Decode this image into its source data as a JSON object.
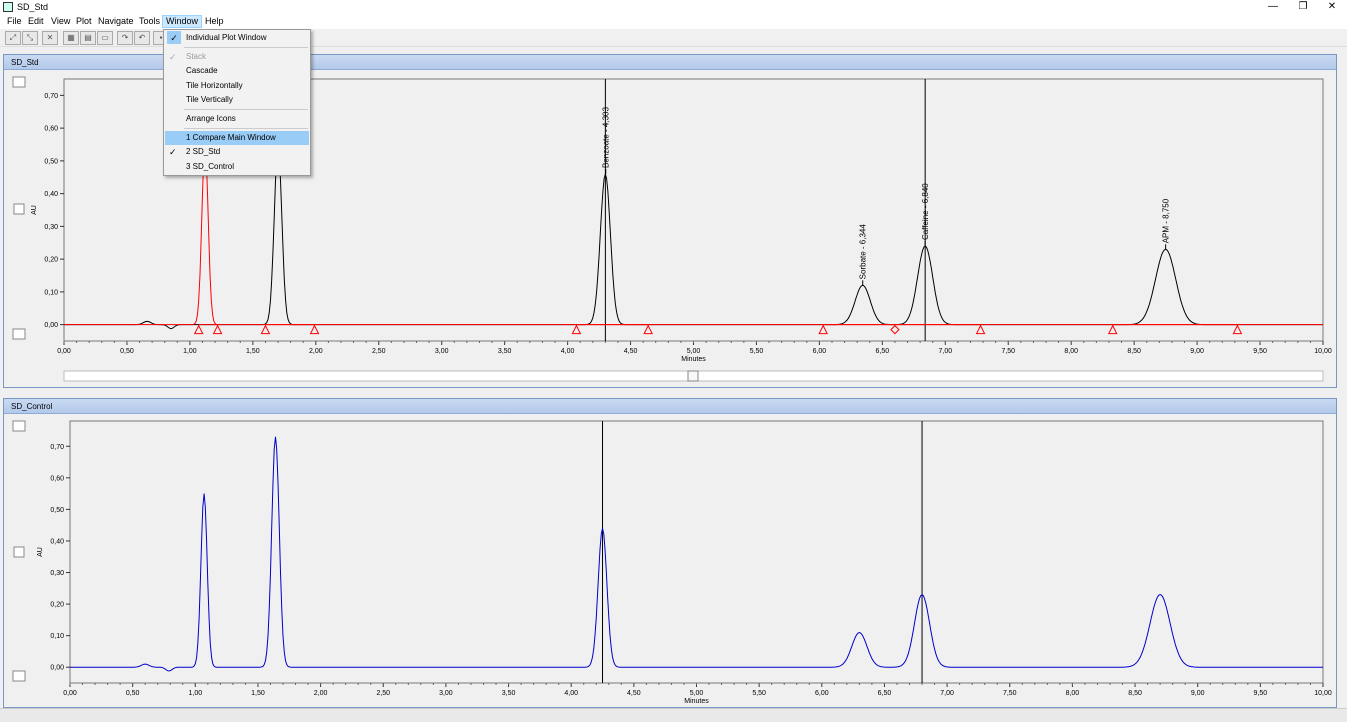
{
  "window": {
    "title": "SD_Std",
    "minimize": "—",
    "restore": "❐",
    "close": "✕"
  },
  "menu": [
    "File",
    "Edit",
    "View",
    "Plot",
    "Navigate",
    "Tools",
    "Window",
    "Help"
  ],
  "window_menu": {
    "individual_plot": "Individual Plot Window",
    "stack": "Stack",
    "cascade": "Cascade",
    "tile_h": "Tile Horizontally",
    "tile_v": "Tile Vertically",
    "arrange": "Arrange Icons",
    "win1": "1 Compare Main Window",
    "win2": "2 SD_Std",
    "win3": "3 SD_Control"
  },
  "panels": {
    "top_title": "SD_Std",
    "bottom_title": "SD_Control"
  },
  "chart_data": [
    {
      "type": "line",
      "title": "SD_Std",
      "xlabel": "Minutes",
      "ylabel": "AU",
      "xlim": [
        0,
        10
      ],
      "ylim": [
        -0.05,
        0.75
      ],
      "x_ticks": [
        "0,00",
        "0,50",
        "1,00",
        "1,50",
        "2,00",
        "2,50",
        "3,00",
        "3,50",
        "4,00",
        "4,50",
        "5,00",
        "5,50",
        "6,00",
        "6,50",
        "7,00",
        "7,50",
        "8,00",
        "8,50",
        "9,00",
        "9,50",
        "10,00"
      ],
      "y_ticks": [
        "0,00",
        "0,10",
        "0,20",
        "0,30",
        "0,40",
        "0,50",
        "0,60",
        "0,70"
      ],
      "series": [
        {
          "color": "#000000",
          "peaks": [
            [
              0.66,
              0.01,
              0.03
            ],
            [
              1.7,
              0.55,
              0.03
            ],
            [
              4.3,
              0.46,
              0.04
            ],
            [
              6.344,
              0.12,
              0.06
            ],
            [
              6.84,
              0.24,
              0.06
            ],
            [
              8.75,
              0.23,
              0.08
            ]
          ]
        },
        {
          "color": "#ff0000",
          "peaks": [
            [
              1.12,
              0.55,
              0.025
            ]
          ]
        }
      ],
      "peak_labels": [
        {
          "x": 4.303,
          "y": 0.46,
          "text": "Benzoate - 4,303"
        },
        {
          "x": 6.344,
          "y": 0.12,
          "text": "Sorbate - 6,344"
        },
        {
          "x": 6.84,
          "y": 0.24,
          "text": "Caffeine - 6,840"
        },
        {
          "x": 8.75,
          "y": 0.23,
          "text": "APM - 8,750"
        }
      ],
      "cursor_lines": [
        4.3,
        6.84
      ],
      "triangle_markers": [
        1.07,
        1.22,
        1.6,
        1.99,
        4.07,
        4.64,
        6.03,
        7.28,
        8.33,
        9.32
      ],
      "diamond_markers": [
        6.6
      ]
    },
    {
      "type": "line",
      "title": "SD_Control",
      "xlabel": "Minutes",
      "ylabel": "AU",
      "xlim": [
        0,
        10
      ],
      "ylim": [
        -0.05,
        0.78
      ],
      "x_ticks": [
        "0,00",
        "0,50",
        "1,00",
        "1,50",
        "2,00",
        "2,50",
        "3,00",
        "3,50",
        "4,00",
        "4,50",
        "5,00",
        "5,50",
        "6,00",
        "6,50",
        "7,00",
        "7,50",
        "8,00",
        "8,50",
        "9,00",
        "9,50",
        "10,00"
      ],
      "y_ticks": [
        "0,00",
        "0,10",
        "0,20",
        "0,30",
        "0,40",
        "0,50",
        "0,60",
        "0,70"
      ],
      "series": [
        {
          "color": "#0000cc",
          "peaks": [
            [
              0.6,
              0.01,
              0.03
            ],
            [
              1.07,
              0.55,
              0.025
            ],
            [
              1.64,
              0.73,
              0.03
            ],
            [
              4.25,
              0.44,
              0.035
            ],
            [
              6.3,
              0.11,
              0.06
            ],
            [
              6.8,
              0.23,
              0.06
            ],
            [
              8.7,
              0.23,
              0.08
            ]
          ]
        }
      ],
      "cursor_lines": [
        4.25,
        6.8
      ]
    }
  ]
}
